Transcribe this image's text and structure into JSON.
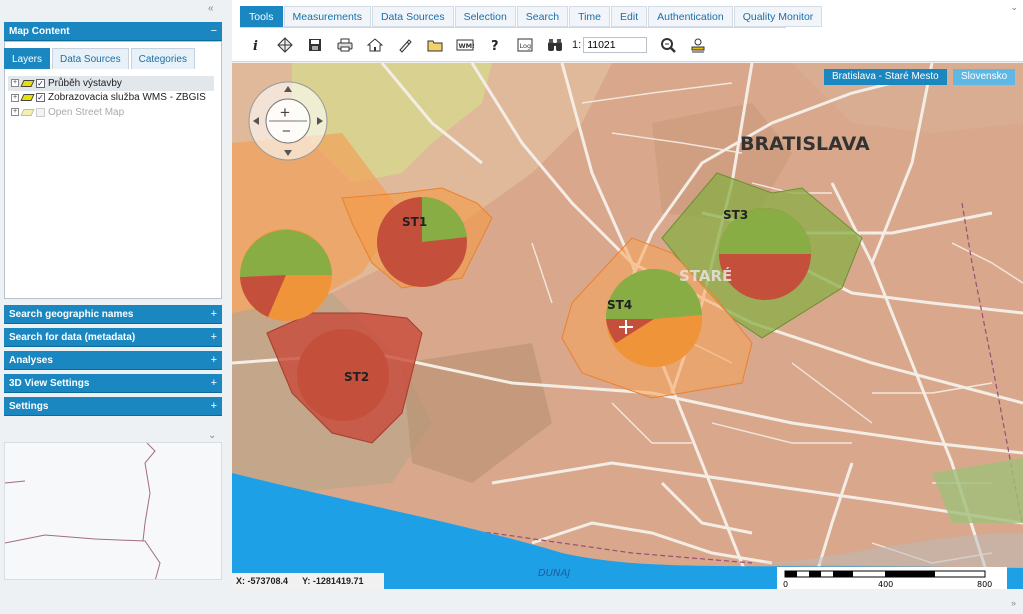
{
  "left_panel": {
    "map_content": {
      "title": "Map Content",
      "toggle": "−",
      "tabs": [
        "Layers",
        "Data Sources",
        "Categories"
      ],
      "layers": [
        {
          "label": "Průběh výstavby",
          "checked": true
        },
        {
          "label": "Zobrazovacia služba WMS - ZBGIS",
          "checked": true
        },
        {
          "label": "Open Street Map",
          "checked": false
        }
      ]
    },
    "sections": [
      {
        "title": "Search geographic names",
        "toggle": "+"
      },
      {
        "title": "Search for data (metadata)",
        "toggle": "+"
      },
      {
        "title": "Analyses",
        "toggle": "+"
      },
      {
        "title": "3D View Settings",
        "toggle": "+"
      },
      {
        "title": "Settings",
        "toggle": "+"
      }
    ]
  },
  "toolbar": {
    "tabs": [
      "Tools",
      "Measurements",
      "Data Sources",
      "Selection",
      "Search",
      "Time",
      "Edit",
      "Authentication",
      "Quality Monitor"
    ],
    "active_tab": "Tools",
    "tools": [
      "info-icon",
      "layers-icon",
      "save-icon",
      "print-icon",
      "home-icon",
      "draw-icon",
      "open-folder-icon",
      "wms-icon",
      "help-icon",
      "log-icon",
      "binoculars-icon"
    ],
    "scale_prefix": "1:",
    "scale_value": "11021"
  },
  "map": {
    "location_badges": [
      "Bratislava - Staré Mesto",
      "Slovensko"
    ],
    "city_label": "BRATISLAVA",
    "district_label": "STARÉ",
    "river_label": "DUNAJ",
    "stations": [
      "ST1",
      "ST2",
      "ST3",
      "ST4"
    ],
    "coords": {
      "x_label": "X:",
      "x_value": "-573708.4",
      "y_label": "Y:",
      "y_value": "-1281419.71"
    },
    "scalebar": {
      "labels": [
        "0",
        "400",
        "800"
      ]
    },
    "colors": {
      "green": "#88ad45",
      "red": "#c4503c",
      "orange": "#f0943a",
      "water": "#1ea0e6",
      "accent": "#1a87c0"
    }
  }
}
